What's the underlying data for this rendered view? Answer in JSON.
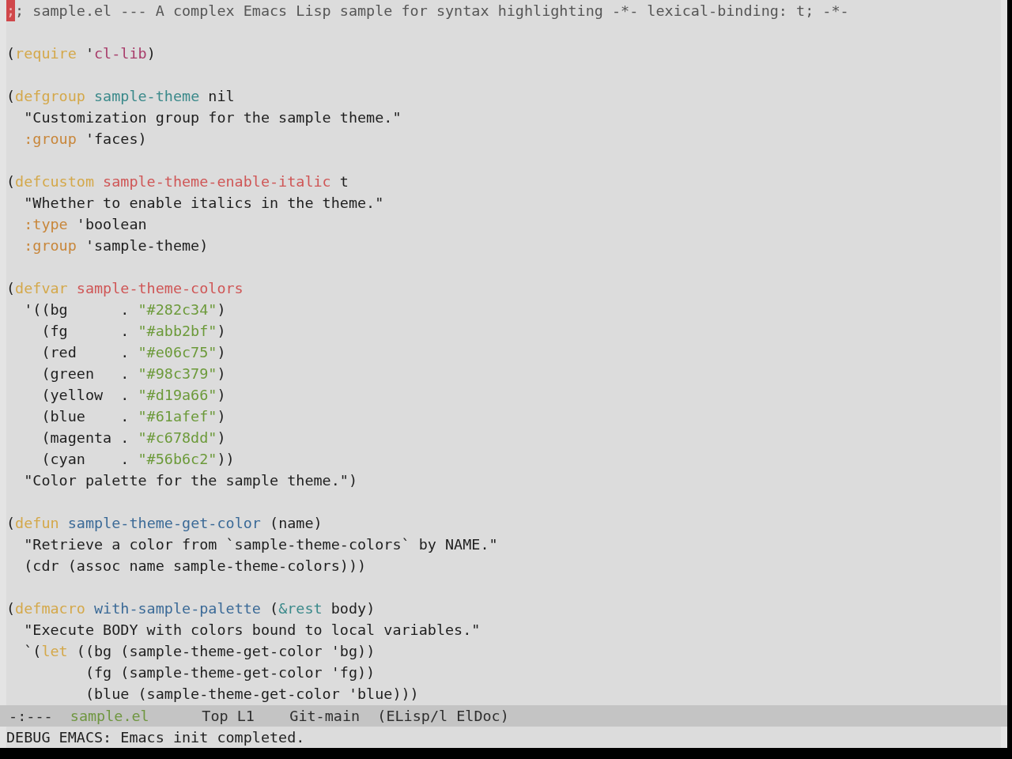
{
  "buffer": {
    "lines": [
      {
        "kind": "code",
        "tokens": [
          {
            "text": ";",
            "kind": "cursor"
          },
          {
            "text": "; sample.el --- A complex Emacs Lisp sample for syntax highlighting -*- lexical-binding: t; -*-",
            "kind": "comment"
          }
        ]
      },
      {
        "kind": "blank"
      },
      {
        "kind": "code",
        "tokens": [
          {
            "text": "(",
            "kind": "plain"
          },
          {
            "text": "require",
            "kind": "keyword"
          },
          {
            "text": " '",
            "kind": "plain"
          },
          {
            "text": "cl-lib",
            "kind": "constant"
          },
          {
            "text": ")",
            "kind": "plain"
          }
        ]
      },
      {
        "kind": "blank"
      },
      {
        "kind": "code",
        "tokens": [
          {
            "text": "(",
            "kind": "plain"
          },
          {
            "text": "defgroup",
            "kind": "keyword"
          },
          {
            "text": " sample-theme",
            "kind": "type"
          },
          {
            "text": " nil",
            "kind": "plain"
          }
        ]
      },
      {
        "kind": "code",
        "tokens": [
          {
            "text": "  \"Customization group for the sample theme.\"",
            "kind": "plain"
          }
        ]
      },
      {
        "kind": "code",
        "tokens": [
          {
            "text": "  :group",
            "kind": "builtin"
          },
          {
            "text": " 'faces)",
            "kind": "plain"
          }
        ]
      },
      {
        "kind": "blank"
      },
      {
        "kind": "code",
        "tokens": [
          {
            "text": "(",
            "kind": "plain"
          },
          {
            "text": "defcustom",
            "kind": "keyword"
          },
          {
            "text": " sample-theme-enable-italic",
            "kind": "variable"
          },
          {
            "text": " t",
            "kind": "plain"
          }
        ]
      },
      {
        "kind": "code",
        "tokens": [
          {
            "text": "  \"Whether to enable italics in the theme.\"",
            "kind": "plain"
          }
        ]
      },
      {
        "kind": "code",
        "tokens": [
          {
            "text": "  :type",
            "kind": "builtin"
          },
          {
            "text": " 'boolean",
            "kind": "plain"
          }
        ]
      },
      {
        "kind": "code",
        "tokens": [
          {
            "text": "  :group",
            "kind": "builtin"
          },
          {
            "text": " 'sample-theme)",
            "kind": "plain"
          }
        ]
      },
      {
        "kind": "blank"
      },
      {
        "kind": "code",
        "tokens": [
          {
            "text": "(",
            "kind": "plain"
          },
          {
            "text": "defvar",
            "kind": "keyword"
          },
          {
            "text": " sample-theme-colors",
            "kind": "variable"
          }
        ]
      },
      {
        "kind": "code",
        "tokens": [
          {
            "text": "  '((bg      . ",
            "kind": "plain"
          },
          {
            "text": "\"#282c34\"",
            "kind": "string"
          },
          {
            "text": ")",
            "kind": "plain"
          }
        ]
      },
      {
        "kind": "code",
        "tokens": [
          {
            "text": "    (fg      . ",
            "kind": "plain"
          },
          {
            "text": "\"#abb2bf\"",
            "kind": "string"
          },
          {
            "text": ")",
            "kind": "plain"
          }
        ]
      },
      {
        "kind": "code",
        "tokens": [
          {
            "text": "    (red     . ",
            "kind": "plain"
          },
          {
            "text": "\"#e06c75\"",
            "kind": "string"
          },
          {
            "text": ")",
            "kind": "plain"
          }
        ]
      },
      {
        "kind": "code",
        "tokens": [
          {
            "text": "    (green   . ",
            "kind": "plain"
          },
          {
            "text": "\"#98c379\"",
            "kind": "string"
          },
          {
            "text": ")",
            "kind": "plain"
          }
        ]
      },
      {
        "kind": "code",
        "tokens": [
          {
            "text": "    (yellow  . ",
            "kind": "plain"
          },
          {
            "text": "\"#d19a66\"",
            "kind": "string"
          },
          {
            "text": ")",
            "kind": "plain"
          }
        ]
      },
      {
        "kind": "code",
        "tokens": [
          {
            "text": "    (blue    . ",
            "kind": "plain"
          },
          {
            "text": "\"#61afef\"",
            "kind": "string"
          },
          {
            "text": ")",
            "kind": "plain"
          }
        ]
      },
      {
        "kind": "code",
        "tokens": [
          {
            "text": "    (magenta . ",
            "kind": "plain"
          },
          {
            "text": "\"#c678dd\"",
            "kind": "string"
          },
          {
            "text": ")",
            "kind": "plain"
          }
        ]
      },
      {
        "kind": "code",
        "tokens": [
          {
            "text": "    (cyan    . ",
            "kind": "plain"
          },
          {
            "text": "\"#56b6c2\"",
            "kind": "string"
          },
          {
            "text": "))",
            "kind": "plain"
          }
        ]
      },
      {
        "kind": "code",
        "tokens": [
          {
            "text": "  \"Color palette for the sample theme.\")",
            "kind": "plain"
          }
        ]
      },
      {
        "kind": "blank"
      },
      {
        "kind": "code",
        "tokens": [
          {
            "text": "(",
            "kind": "plain"
          },
          {
            "text": "defun",
            "kind": "keyword"
          },
          {
            "text": " sample-theme-get-color",
            "kind": "function"
          },
          {
            "text": " (name)",
            "kind": "plain"
          }
        ]
      },
      {
        "kind": "code",
        "tokens": [
          {
            "text": "  \"Retrieve a color from `sample-theme-colors` by NAME.\"",
            "kind": "plain"
          }
        ]
      },
      {
        "kind": "code",
        "tokens": [
          {
            "text": "  (cdr (assoc name sample-theme-colors)))",
            "kind": "plain"
          }
        ]
      },
      {
        "kind": "blank"
      },
      {
        "kind": "code",
        "tokens": [
          {
            "text": "(",
            "kind": "plain"
          },
          {
            "text": "defmacro",
            "kind": "keyword"
          },
          {
            "text": " with-sample-palette",
            "kind": "function"
          },
          {
            "text": " (",
            "kind": "plain"
          },
          {
            "text": "&rest",
            "kind": "type"
          },
          {
            "text": " body)",
            "kind": "plain"
          }
        ]
      },
      {
        "kind": "code",
        "tokens": [
          {
            "text": "  \"Execute BODY with colors bound to local variables.\"",
            "kind": "plain"
          }
        ]
      },
      {
        "kind": "code",
        "tokens": [
          {
            "text": "  `(",
            "kind": "plain"
          },
          {
            "text": "let",
            "kind": "keyword"
          },
          {
            "text": " ((bg (sample-theme-get-color 'bg))",
            "kind": "plain"
          }
        ]
      },
      {
        "kind": "code",
        "tokens": [
          {
            "text": "         (fg (sample-theme-get-color 'fg))",
            "kind": "plain"
          }
        ]
      },
      {
        "kind": "code",
        "tokens": [
          {
            "text": "         (blue (sample-theme-get-color 'blue)))",
            "kind": "plain"
          }
        ]
      }
    ]
  },
  "mode_line": {
    "status": "-:---",
    "buffer_name": "sample.el",
    "position": "Top L1",
    "vc_branch": "Git-main",
    "modes": "(ELisp/l ElDoc)"
  },
  "echo_area": {
    "message": "DEBUG EMACS: Emacs init completed."
  }
}
